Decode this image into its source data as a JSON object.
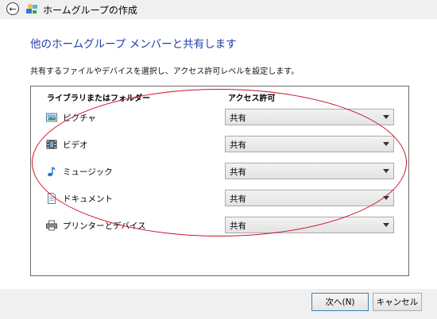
{
  "window": {
    "title": "ホームグループの作成"
  },
  "page": {
    "heading": "他のホームグループ メンバーと共有します",
    "description": "共有するファイルやデバイスを選択し、アクセス許可レベルを設定します。"
  },
  "table": {
    "col_library": "ライブラリまたはフォルダー",
    "col_access": "アクセス許可",
    "rows": [
      {
        "label": "ピクチャ",
        "icon": "pictures-icon",
        "value": "共有"
      },
      {
        "label": "ビデオ",
        "icon": "videos-icon",
        "value": "共有"
      },
      {
        "label": "ミュージック",
        "icon": "music-icon",
        "value": "共有"
      },
      {
        "label": "ドキュメント",
        "icon": "documents-icon",
        "value": "共有"
      },
      {
        "label": "プリンターとデバイス",
        "icon": "printer-icon",
        "value": "共有"
      }
    ]
  },
  "buttons": {
    "next": "次へ(N)",
    "cancel": "キャンセル"
  },
  "colors": {
    "heading": "#1f3ea8",
    "highlight_ellipse": "#d0102a"
  }
}
